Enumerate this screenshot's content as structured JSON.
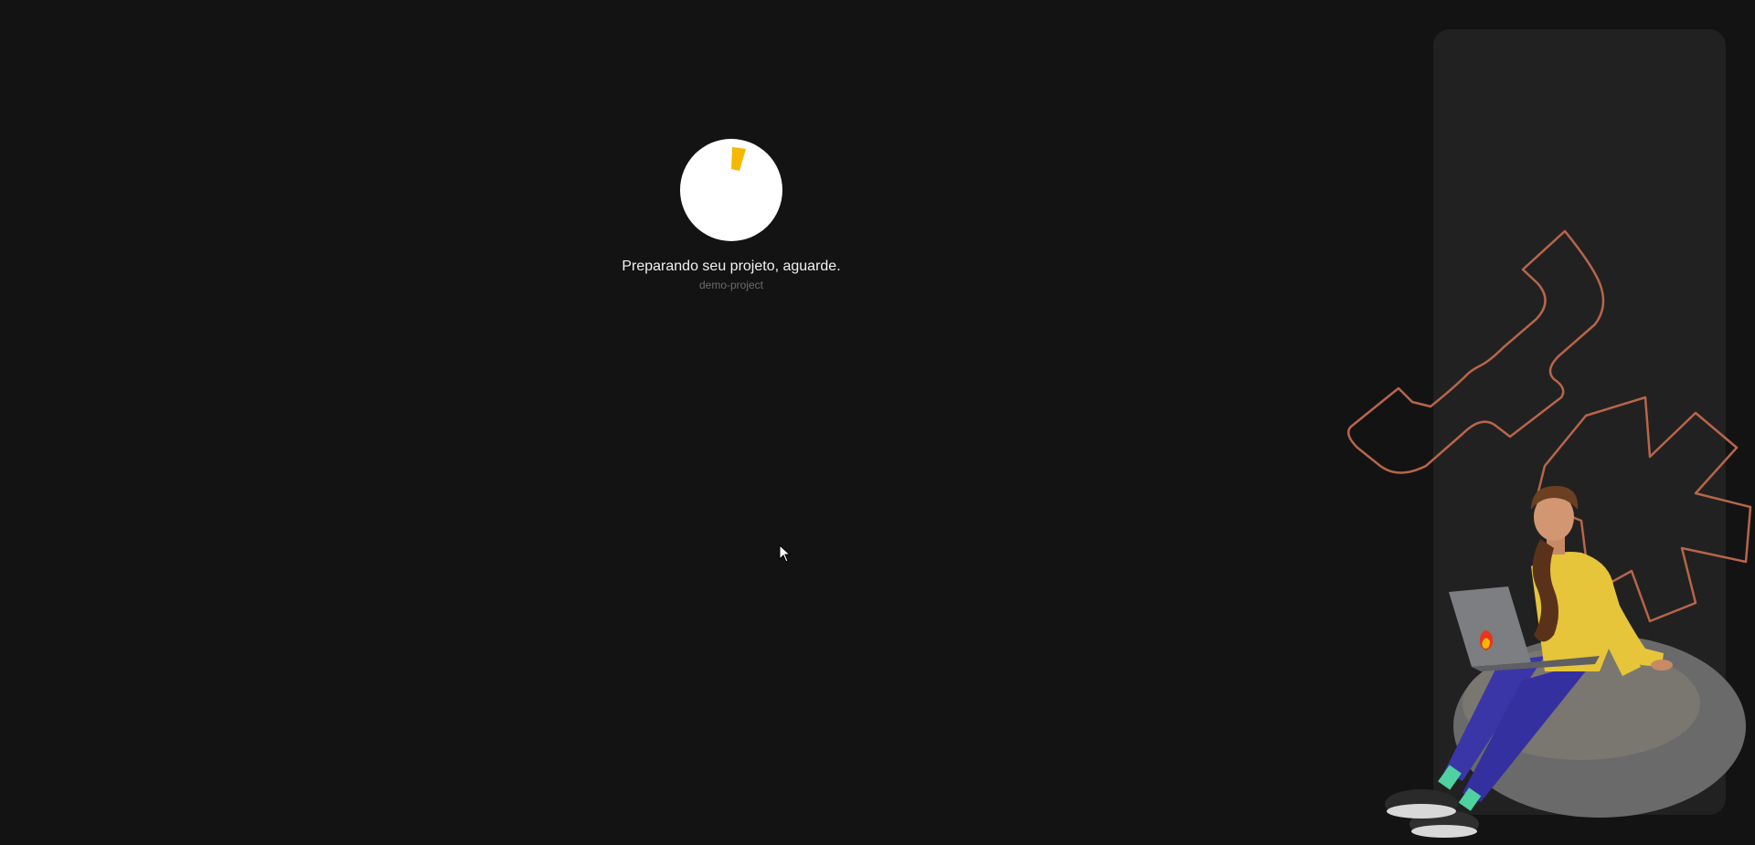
{
  "loading": {
    "message": "Preparando seu projeto, aguarde.",
    "project": "demo-project"
  },
  "colors": {
    "background": "#131313",
    "panel": "#212121",
    "accent": "#f5b800",
    "outline": "#b8654a"
  },
  "icons": [
    "spinner-icon",
    "mouse-cursor-icon"
  ]
}
